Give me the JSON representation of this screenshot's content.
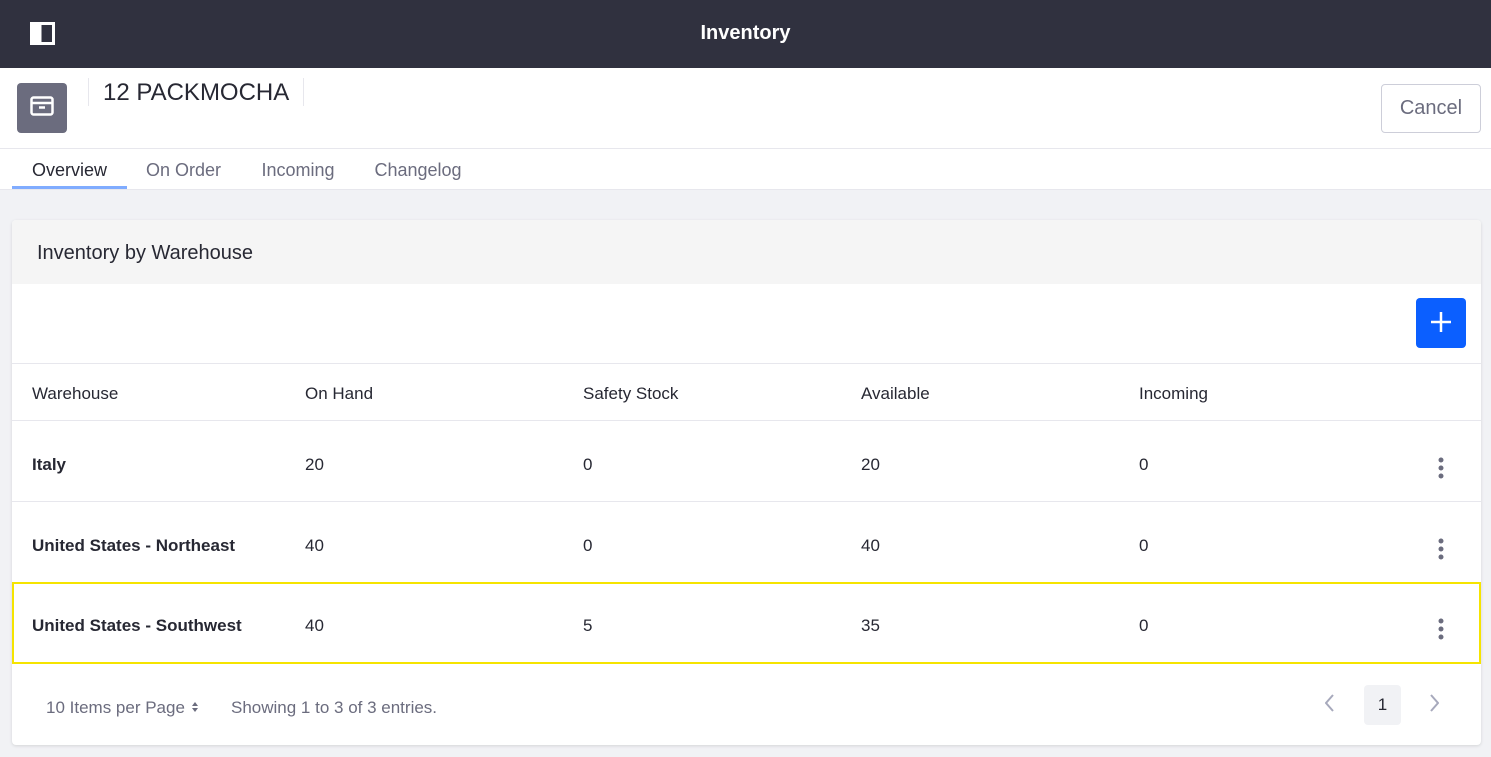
{
  "topbar": {
    "title": "Inventory",
    "toggle_icon": "sidebar-toggle-icon"
  },
  "header": {
    "sticker_icon": "archive-icon",
    "item_title": "12 PACKMOCHA",
    "cancel_label": "Cancel"
  },
  "tabs": [
    {
      "label": "Overview",
      "active": true
    },
    {
      "label": "On Order",
      "active": false
    },
    {
      "label": "Incoming",
      "active": false
    },
    {
      "label": "Changelog",
      "active": false
    }
  ],
  "card": {
    "title": "Inventory by Warehouse",
    "add_icon": "plus-icon",
    "columns": [
      "Warehouse",
      "On Hand",
      "Safety Stock",
      "Available",
      "Incoming"
    ],
    "rows": [
      {
        "warehouse": "Italy",
        "on_hand": "20",
        "safety_stock": "0",
        "available": "20",
        "incoming": "0"
      },
      {
        "warehouse": "United States - Northeast",
        "on_hand": "40",
        "safety_stock": "0",
        "available": "40",
        "incoming": "0"
      },
      {
        "warehouse": "United States - Southwest",
        "on_hand": "40",
        "safety_stock": "5",
        "available": "35",
        "incoming": "0",
        "highlighted": true
      }
    ],
    "highlight_color": "#f5e400"
  },
  "footer": {
    "per_page_label": "10 Items per Page",
    "showing_text": "Showing 1 to 3 of 3 entries.",
    "current_page": "1"
  },
  "colors": {
    "topbar": "#30313f",
    "primary": "#0b5fff",
    "active_tab_underline": "#80acff"
  }
}
